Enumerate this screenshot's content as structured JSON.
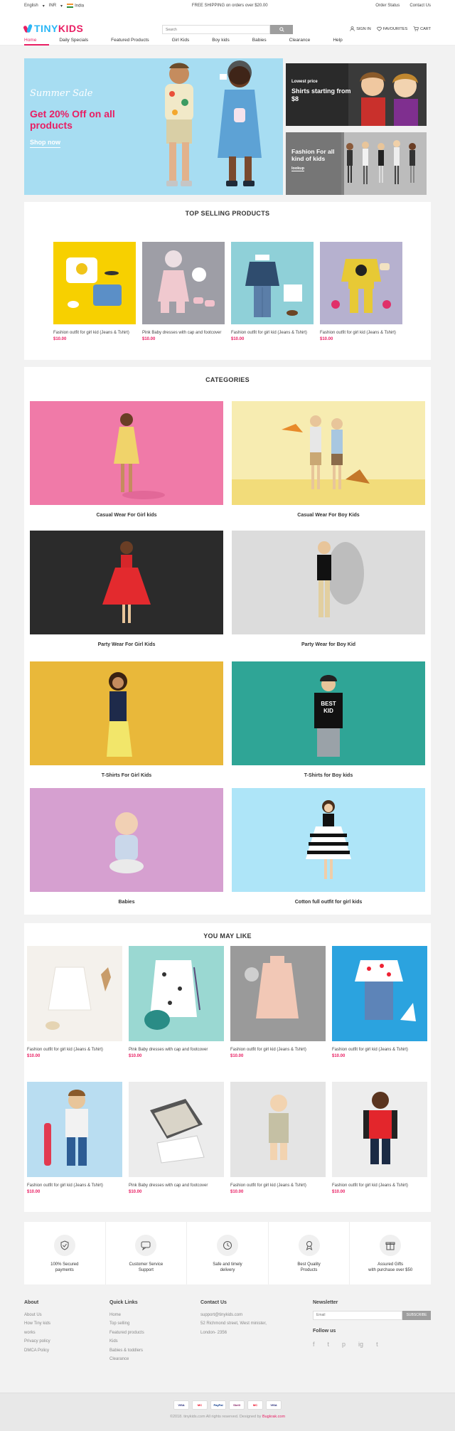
{
  "topbar": {
    "language": "English",
    "currency": "INR",
    "country": "India",
    "shipping": "FREE SHIPPING on orders over $20.00",
    "order_status": "Order Status",
    "contact": "Contact Us"
  },
  "header": {
    "logo_a": "TINY",
    "logo_b": "KIDS",
    "search_placeholder": "Search",
    "sign_in": "SIGN IN",
    "favourites": "FAVOURITES",
    "cart": "CART"
  },
  "nav": [
    "Home",
    "Daily Specials",
    "Featured Products",
    "Girl Kids",
    "Boy kids",
    "Babies",
    "Clearance",
    "Help"
  ],
  "hero": {
    "script": "Summer Sale",
    "offer": "Get 20% Off on all products",
    "cta": "Shop now"
  },
  "banner1": {
    "small": "Lowest price",
    "big": "Shirts starting from $8"
  },
  "banner2": {
    "big": "Fashion For all kind of kids",
    "cta": "lookup"
  },
  "top_selling": {
    "title": "TOP SELLING PRODUCTS",
    "items": [
      {
        "name": "Fashion outfit for girl kid (Jeans & Tshirt)",
        "price": "$10.00"
      },
      {
        "name": "Pink Baby dresses with cap and footcover",
        "price": "$10.00"
      },
      {
        "name": "Fashion outfit for girl kid (Jeans & Tshirt)",
        "price": "$10.00"
      },
      {
        "name": "Fashion outfit for girl kid (Jeans & Tshirt)",
        "price": "$10.00"
      }
    ]
  },
  "categories": {
    "title": "CATEGORIES",
    "items": [
      {
        "label": "Casual Wear For Girl kids",
        "color": "#f07aa8"
      },
      {
        "label": "Casual Wear For Boy Kids",
        "color": "#f7ecb1"
      },
      {
        "label": "Party Wear For Girl Kids",
        "color": "#2b2b2b"
      },
      {
        "label": "Party Wear for Boy Kid",
        "color": "#dcdcdc"
      },
      {
        "label": "T-Shirts For Girl Kids",
        "color": "#e9b83a"
      },
      {
        "label": "T-Shirts for Boy kids",
        "color": "#2fa596"
      },
      {
        "label": "Babies",
        "color": "#d6a0d0"
      },
      {
        "label": "Cotton full outfit for girl kids",
        "color": "#aee5f8"
      }
    ]
  },
  "you_may_like": {
    "title": "YOU MAY LIKE",
    "items": [
      {
        "name": "Fashion outfit for girl kid (Jeans & Tshirt)",
        "price": "$10.00"
      },
      {
        "name": "Pink Baby dresses with cap and footcover",
        "price": "$10.00"
      },
      {
        "name": "Fashion outfit for girl kid (Jeans & Tshirt)",
        "price": "$10.00"
      },
      {
        "name": "Fashion outfit for girl kid (Jeans & Tshirt)",
        "price": "$10.00"
      },
      {
        "name": "Fashion outfit for girl kid (Jeans & Tshirt)",
        "price": "$10.00"
      },
      {
        "name": "Pink Baby dresses with cap and footcover",
        "price": "$10.00"
      },
      {
        "name": "Fashion outfit for girl kid (Jeans & Tshirt)",
        "price": "$10.00"
      },
      {
        "name": "Fashion outfit for girl kid (Jeans & Tshirt)",
        "price": "$10.00"
      }
    ]
  },
  "features": [
    {
      "line1": "100% Secured",
      "line2": "payments",
      "icon": "shield-icon"
    },
    {
      "line1": "Customer Service",
      "line2": "Support",
      "icon": "chat-icon"
    },
    {
      "line1": "Safe and timely",
      "line2": "delivery",
      "icon": "clock-icon"
    },
    {
      "line1": "Best Quality",
      "line2": "Products",
      "icon": "award-icon"
    },
    {
      "line1": "Assured Gifts",
      "line2": "with purchase over $50",
      "icon": "gift-icon"
    }
  ],
  "footer": {
    "about_title": "About",
    "about": [
      "About Us",
      "How Tiny kids",
      "works",
      "Privacy policy",
      "DMCA Policy"
    ],
    "quick_title": "Quick Links",
    "quick": [
      "Home",
      "Top selling",
      "Featured products",
      "Kids",
      "Babies & toddlers",
      "Clearance"
    ],
    "contact_title": "Contact Us",
    "contact": [
      "support@tinykids.com",
      "52 Richmond street, West minister,",
      "London- 2356"
    ],
    "newsletter_title": "Newsletter",
    "email_placeholder": "Email",
    "subscribe": "SUBSCRIBE",
    "follow": "Follow us",
    "social": [
      "f",
      "t",
      "p",
      "ig",
      "t"
    ]
  },
  "payments": [
    "VISA",
    "MC",
    "PayPal",
    "Skrill",
    "MC",
    "VISA"
  ],
  "copyright": "©2018. tinykids.com All rights reserved. Designed by",
  "designer": "Bugkrak.com"
}
